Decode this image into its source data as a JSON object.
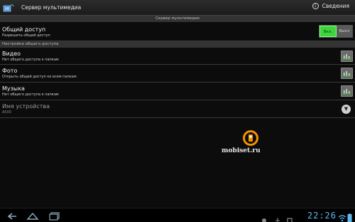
{
  "action_bar": {
    "title": "Сервер мультимедиа",
    "about_label": "Сведения"
  },
  "sections": {
    "server_header": "Сервер мультимедиа",
    "settings_header": "Настройка общего доступа"
  },
  "sharing": {
    "title": "Общий доступ",
    "subtitle": "Разрешить общий доступ",
    "toggle_on": "Вкл.",
    "toggle_off": "Выкл"
  },
  "items": [
    {
      "title": "Видео",
      "subtitle": "Нет общего доступа к папкам"
    },
    {
      "title": "Фото",
      "subtitle": "Открыть общий доступ ко всем папкам"
    },
    {
      "title": "Музыка",
      "subtitle": "Нет общего доступа к папкам"
    }
  ],
  "device_name": {
    "title": "Имя устройства",
    "value": "A500"
  },
  "watermark": "mobiset.ru",
  "status_bar": {
    "clock": "22:26"
  },
  "colors": {
    "toggle_on": "#3fd33f",
    "clock": "#5fb8f0",
    "watermark_accent": "#f39200"
  }
}
